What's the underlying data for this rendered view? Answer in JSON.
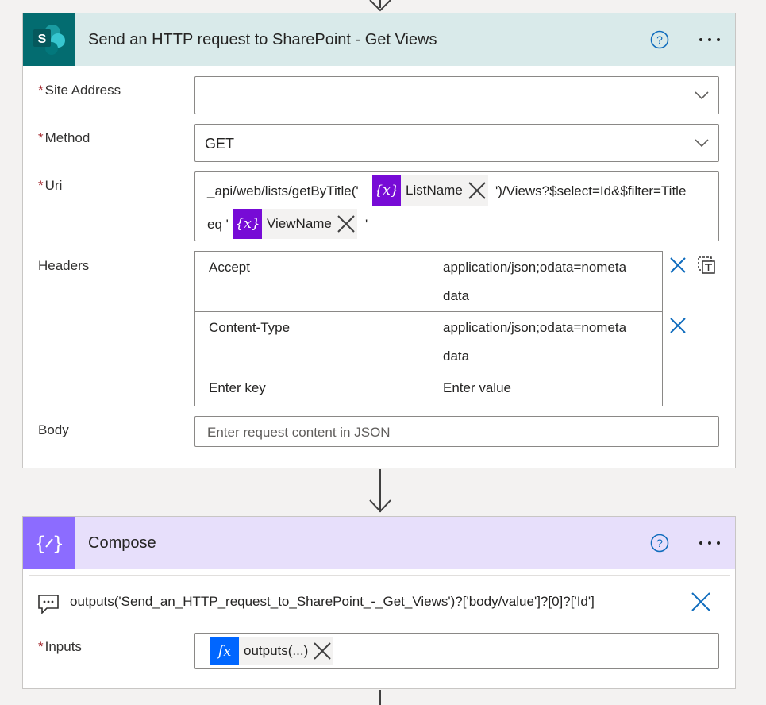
{
  "http_card": {
    "title": "Send an HTTP request to SharePoint - Get Views",
    "icon": "sharepoint-icon",
    "icon_letter": "S",
    "fields": {
      "site_address": {
        "label": "Site Address",
        "required": "*",
        "value": ""
      },
      "method": {
        "label": "Method",
        "required": "*",
        "value": "GET"
      },
      "uri": {
        "label": "Uri",
        "required": "*",
        "part1": "_api/web/lists/getByTitle('",
        "token1": "ListName",
        "part2": "')/Views?$select=Id&$filter=Title",
        "part3": "eq '",
        "token2": "ViewName",
        "part4": "'"
      },
      "headers": {
        "label": "Headers",
        "rows": [
          {
            "key": "Accept",
            "value_line1": "application/json;odata=nometa",
            "value_line2": "data"
          },
          {
            "key": "Content-Type",
            "value_line1": "application/json;odata=nometa",
            "value_line2": "data"
          }
        ],
        "key_placeholder": "Enter key",
        "value_placeholder": "Enter value"
      },
      "body": {
        "label": "Body",
        "placeholder": "Enter request content in JSON"
      }
    },
    "token_icon_text": "{x}"
  },
  "compose_card": {
    "title": "Compose",
    "icon": "compose-icon",
    "comment": "outputs('Send_an_HTTP_request_to_SharePoint_-_Get_Views')?['body/value']?[0]?['Id']",
    "inputs": {
      "label": "Inputs",
      "required": "*",
      "token": "outputs(...)",
      "token_icon_text": "fx"
    }
  },
  "colors": {
    "sharepoint_header_bg": "#d9eaea",
    "sharepoint_icon_bg": "#036c70",
    "compose_header_bg": "#e7dffb",
    "compose_icon_bg": "#8c6cff",
    "accent_blue": "#0f6cbd",
    "variable_token": "#770bd6",
    "expression_token": "#0066ff"
  }
}
